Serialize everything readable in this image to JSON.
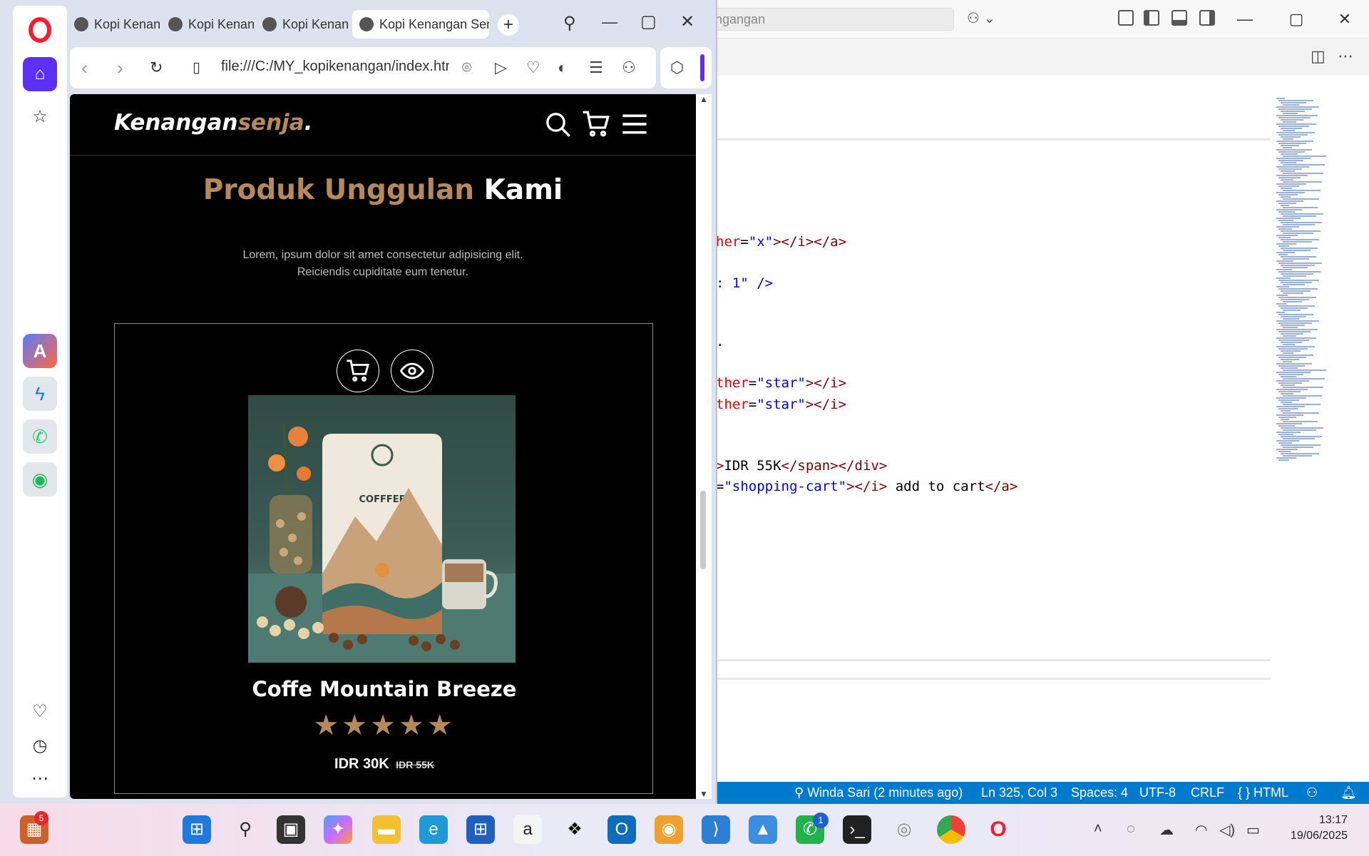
{
  "vscode": {
    "search_text": "ngangan",
    "code_lines": [
      {
        "parts": [
          {
            "t": "her",
            "c": "attr"
          },
          {
            "t": "=",
            "c": ""
          },
          {
            "t": "\"x\"",
            "c": "str"
          },
          {
            "t": "></i></a>",
            "c": "tag"
          }
        ]
      },
      {
        "parts": [
          {
            "t": ": 1\" />",
            "c": "str"
          }
        ]
      },
      {
        "parts": [
          {
            "t": ".",
            "c": ""
          }
        ]
      },
      {
        "parts": [
          {
            "t": "ther",
            "c": "attr"
          },
          {
            "t": "=",
            "c": ""
          },
          {
            "t": "\"star\"",
            "c": "str"
          },
          {
            "t": "></i>",
            "c": "tag"
          }
        ]
      },
      {
        "parts": [
          {
            "t": "ther",
            "c": "attr"
          },
          {
            "t": "=",
            "c": ""
          },
          {
            "t": "\"star\"",
            "c": "str"
          },
          {
            "t": "></i>",
            "c": "tag"
          }
        ]
      },
      {
        "parts": [
          {
            "t": ">",
            "c": "tag"
          },
          {
            "t": "IDR 55K",
            "c": ""
          },
          {
            "t": "</span></div>",
            "c": "tag"
          }
        ]
      },
      {
        "parts": [
          {
            "t": "=",
            "c": ""
          },
          {
            "t": "\"shopping-cart\"",
            "c": "str"
          },
          {
            "t": "></i>",
            "c": "tag"
          },
          {
            "t": " add to cart",
            "c": ""
          },
          {
            "t": "</a>",
            "c": "tag"
          }
        ]
      }
    ],
    "status": {
      "git": "Winda Sari (2 minutes ago)",
      "position": "Ln 325, Col 3",
      "spaces": "Spaces: 4",
      "encoding": "UTF-8",
      "eol": "CRLF",
      "language": "{ } HTML"
    }
  },
  "browser": {
    "tabs": [
      "Kopi Kenan",
      "Kopi Kenan",
      "Kopi Kenan",
      "Kopi Kenangan Sen"
    ],
    "active_tab": 3,
    "url": "file:///C:/MY_kopikenangan/index.html"
  },
  "site": {
    "logo_main": "Kenangan",
    "logo_accent": "senja",
    "logo_dot": ".",
    "heading_accent": "Produk Unggulan",
    "heading_main": "Kami",
    "description_line1": "Lorem, ipsum dolor sit amet consectetur adipisicing elit.",
    "description_line2": "Reiciendis cupiditate eum tenetur.",
    "product": {
      "name": "Coffe Mountain Breeze",
      "rating": 5,
      "stars": "★★★★★",
      "price": "IDR 30K",
      "old_price": "IDR 55K",
      "bag_label": "COFFFEE"
    },
    "accent_color": "#b6895b"
  },
  "taskbar": {
    "widget_badge": "5",
    "whatsapp_badge": "1",
    "time": "13:17",
    "date": "19/06/2025"
  }
}
